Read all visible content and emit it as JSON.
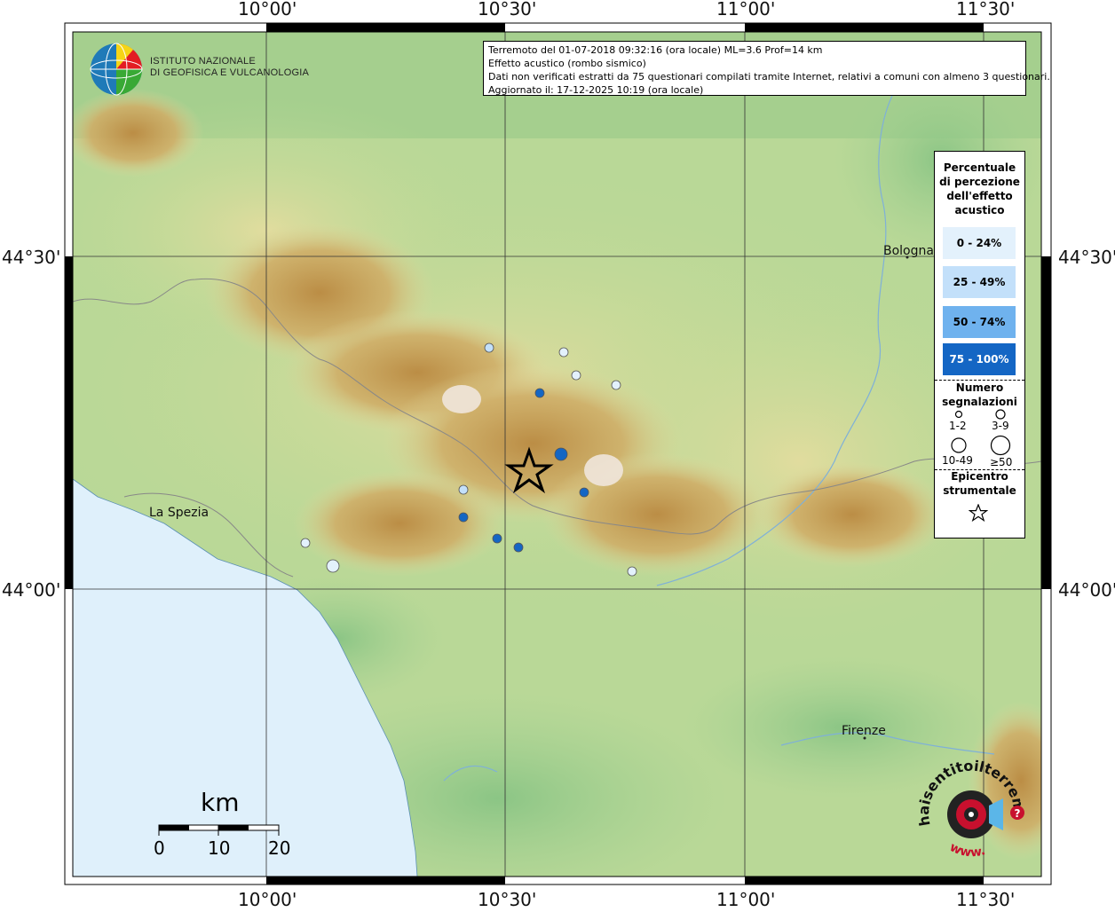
{
  "map": {
    "lon_labels": [
      "10°00'",
      "10°30'",
      "11°00'",
      "11°30'"
    ],
    "lat_labels": [
      "44°30'",
      "44°00'"
    ],
    "colors": {
      "sea": "#dff0fb",
      "lowland": "#98cc8e",
      "hill": "#d8dfa0",
      "mountain": "#c8a35a",
      "peak": "#f2ece6"
    }
  },
  "institute": {
    "line1": "Istituto Nazionale",
    "line2": "di Geofisica e Vulcanologia"
  },
  "info": {
    "line1": "Terremoto del 01-07-2018 09:32:16 (ora locale) ML=3.6 Prof=14 km",
    "line2": "Effetto acustico (rombo sismico)",
    "line3": "Dati non verificati estratti da 75 questionari compilati tramite Internet, relativi a comuni con almeno 3 questionari.",
    "line4": "Aggiornato il: 17-12-2025 10:19 (ora locale)"
  },
  "legend": {
    "title": [
      "Percentuale",
      "di percezione",
      "dell'effetto",
      "acustico"
    ],
    "classes": [
      {
        "label": "0 - 24%",
        "color": "#e3f1fc",
        "text_color": "#000000"
      },
      {
        "label": "25 - 49%",
        "color": "#c3e0fa",
        "text_color": "#000000"
      },
      {
        "label": "50 - 74%",
        "color": "#6fb2ee",
        "text_color": "#000000"
      },
      {
        "label": "75 - 100%",
        "color": "#1466c4",
        "text_color": "#ffffff"
      }
    ],
    "count_title": [
      "Numero",
      "segnalazioni"
    ],
    "count_labels": [
      "1-2",
      "3-9",
      "10-49",
      "≥50"
    ],
    "epicenter_title": [
      "Epicentro",
      "strumentale"
    ]
  },
  "cities": [
    {
      "name": "Bologna"
    },
    {
      "name": "La Spezia"
    },
    {
      "name": "Firenze"
    }
  ],
  "scale_bar": {
    "unit": "km",
    "ticks": [
      "0",
      "10",
      "20"
    ]
  },
  "observations": [
    {
      "class": 1,
      "size": "3-9"
    },
    {
      "class": 0,
      "size": "3-9"
    },
    {
      "class": 0,
      "size": "3-9"
    },
    {
      "class": 0,
      "size": "3-9"
    },
    {
      "class": 3,
      "size": "3-9"
    },
    {
      "class": 3,
      "size": "10-49"
    },
    {
      "class": 1,
      "size": "3-9"
    },
    {
      "class": 3,
      "size": "3-9"
    },
    {
      "class": 3,
      "size": "3-9"
    },
    {
      "class": 3,
      "size": "3-9"
    },
    {
      "class": 3,
      "size": "3-9"
    },
    {
      "class": 0,
      "size": "3-9"
    },
    {
      "class": 0,
      "size": "10-49"
    },
    {
      "class": 0,
      "size": "3-9"
    }
  ],
  "epicenter": {
    "magnitude": "ML=3.6"
  },
  "hsit_logo": {
    "text_top": "haisentitoilterremoto.it",
    "text_bottom": "www."
  }
}
